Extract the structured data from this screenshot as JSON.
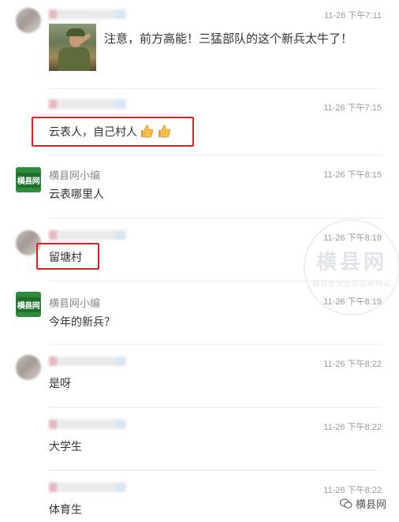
{
  "messages": [
    {
      "name": "",
      "time": "11-26 下午7:11",
      "text": "注意，前方高能！三猛部队的这个新兵太牛了！",
      "has_photo": true
    },
    {
      "name": "",
      "time": "11-26 下午7:15",
      "text": "云表人，自己村人",
      "highlighted": true,
      "emoji": "thumbs-up x2"
    },
    {
      "name": "横县网小编",
      "time": "11-26 下午8:15",
      "text": "云表哪里人"
    },
    {
      "name": "",
      "time": "11-26 下午8:19",
      "text": "留塘村",
      "highlighted": true
    },
    {
      "name": "横县网小编",
      "time": "11-26 下午8:19",
      "text": "今年的新兵？"
    },
    {
      "name": "",
      "time": "11-26 下午8:22",
      "text": "是呀"
    },
    {
      "name": "",
      "time": "11-26 下午8:22",
      "text": "大学生"
    },
    {
      "name": "",
      "time": "11-26 下午8:22",
      "text": "体育生"
    }
  ],
  "brand_avatar_text": "横县网",
  "watermark": {
    "big": "横县网",
    "small": "横县生活资讯品牌网站"
  },
  "corner_logo": {
    "icon": "wechat-icon",
    "label": "横县网"
  },
  "colors": {
    "highlight": "#e02020",
    "brand": "#2e8b3c"
  }
}
